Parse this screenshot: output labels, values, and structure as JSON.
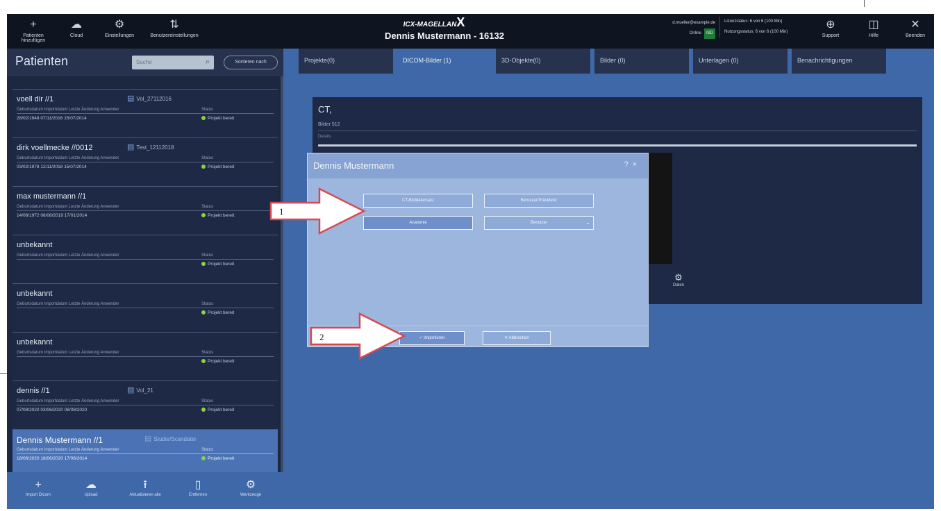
{
  "topbar": {
    "buttons": [
      {
        "label": "Patienten hinzufügen",
        "icon": "plus-icon",
        "glyph": "+"
      },
      {
        "label": "Cloud",
        "icon": "cloud-icon",
        "glyph": "☁"
      },
      {
        "label": "Einstellungen",
        "icon": "gear-icon",
        "glyph": "⚙"
      },
      {
        "label": "Benutzereinstellungen",
        "icon": "sort-icon",
        "glyph": "⇅"
      }
    ],
    "logo_text": "ICX-MAGELLAN",
    "logo_mark": "X",
    "title": "Dennis Mustermann - 16132",
    "user_email": "d.mueller@example.de",
    "online_label": "Online",
    "online_badge": "ISD",
    "license_line1": "Lizenzstatus: 6 von 6 (100 Min)",
    "license_line2": "Nutzungsstatus: 6 von 6 (100 Min)",
    "right_buttons": [
      {
        "label": "Support",
        "icon": "globe-icon",
        "glyph": "⊕"
      },
      {
        "label": "Hilfe",
        "icon": "book-icon",
        "glyph": "◫"
      },
      {
        "label": "Beenden",
        "icon": "close-icon",
        "glyph": "✕"
      }
    ]
  },
  "sidebar": {
    "title": "Patienten",
    "search_placeholder": "Suche",
    "filter_label": "Sortieren nach",
    "meta_header": "Geburtsdatum  Importdatum  Letzte Änderung  Anwender",
    "status_header": "Status",
    "patients": [
      {
        "name": "voell dir //1",
        "doc": "Vol_27112016",
        "dates": "28/02/1948  07/11/2016  15/07/2014",
        "status": "Projekt bereit"
      },
      {
        "name": "dirk voellmecke //0012",
        "doc": "Test_12112018",
        "dates": "03/02/1978  12/11/2018  15/07/2014",
        "status": "Projekt bereit"
      },
      {
        "name": "max mustermann //1",
        "doc": "",
        "dates": "14/08/1972  08/08/2019  17/01/2014",
        "status": "Projekt bereit"
      },
      {
        "name": "unbekannt",
        "doc": "",
        "dates": "",
        "status": "Projekt bereit"
      },
      {
        "name": "unbekannt",
        "doc": "",
        "dates": "",
        "status": "Projekt bereit"
      },
      {
        "name": "unbekannt",
        "doc": "",
        "dates": "",
        "status": "Projekt bereit"
      },
      {
        "name": "dennis //1",
        "doc": "Vol_21",
        "dates": "07/08/2020  03/06/2020  08/08/2020",
        "status": "Projekt bereit"
      },
      {
        "name": "Dennis Mustermann //1",
        "doc": "Studie/Scandatei",
        "dates": "18/06/2020  18/06/2020  17/06/2014",
        "status": "Projekt bereit"
      }
    ],
    "footer": [
      {
        "label": "Import Dicom",
        "icon": "plus-icon",
        "glyph": "+"
      },
      {
        "label": "Upload",
        "icon": "cloud-icon",
        "glyph": "☁"
      },
      {
        "label": "Aktualisieren alle",
        "icon": "upload-icon",
        "glyph": "⭱"
      },
      {
        "label": "Entfernen",
        "icon": "trash-icon",
        "glyph": "▯"
      },
      {
        "label": "Werkzeuge",
        "icon": "gear-icon",
        "glyph": "⚙"
      }
    ]
  },
  "tabs": [
    {
      "label": "Projekte(0)"
    },
    {
      "label": "DICOM-Bilder (1)"
    },
    {
      "label": "3D-Objekte(0)"
    },
    {
      "label": "Bilder (0)"
    },
    {
      "label": "Unterlagen (0)"
    },
    {
      "label": "Benachrichtigungen"
    }
  ],
  "content": {
    "title": "CT,",
    "subtitle": "Bilder 512",
    "sub2": "Details",
    "daten_label": "Daten",
    "daten_icon": "gear-icon"
  },
  "dialog": {
    "title": "Dennis Mustermann",
    "help_glyph": "?",
    "close_glyph": "×",
    "buttons": [
      {
        "label": "CT-Bilddatensatz"
      },
      {
        "label": "Benutzer/Präsidenz"
      },
      {
        "label": "Anatomie"
      },
      {
        "label": "Benutzer"
      }
    ],
    "import_label": "Importieren",
    "cancel_label": "Abbrechen"
  },
  "callouts": [
    {
      "number": "1"
    },
    {
      "number": "2"
    }
  ]
}
